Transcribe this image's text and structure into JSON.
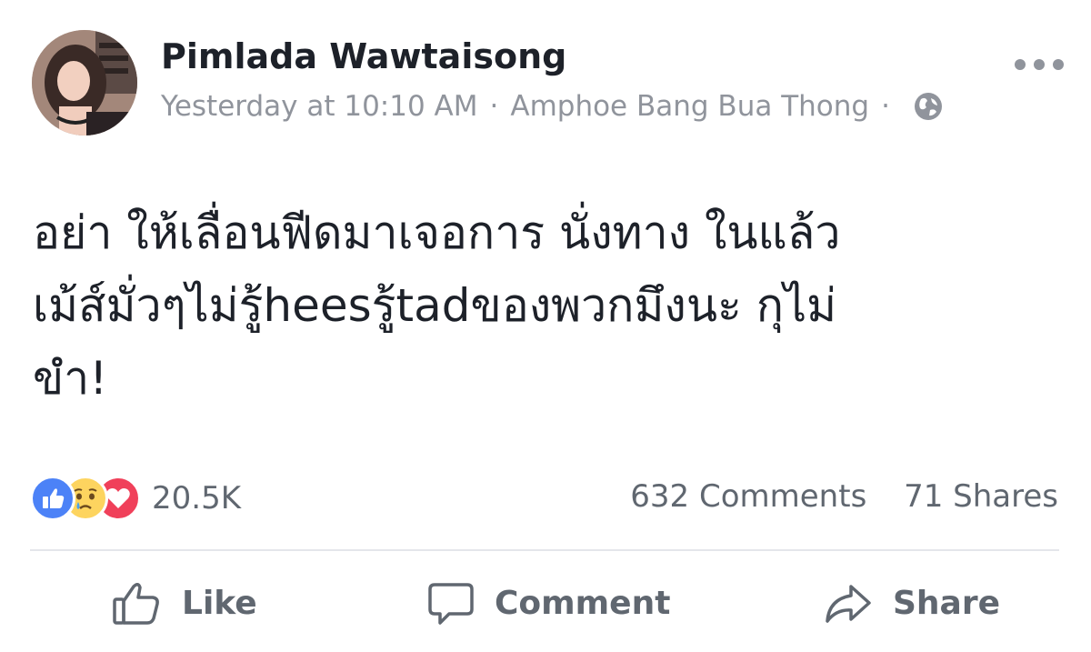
{
  "post": {
    "author": "Pimlada Wawtaisong",
    "timestamp": "Yesterday at 10:10 AM",
    "separator": "·",
    "location": "Amphoe Bang Bua Thong",
    "privacy_icon": "globe-icon",
    "text_lines": [
      "อย่า ให้เลื่อนฟีดมาเจอการ นั่งทาง ในแล้ว",
      "เม้ส์มั่วๆไม่รู้heesรู้tadของพวกมึงนะ กุไม่",
      "ขำ!"
    ]
  },
  "reactions": {
    "icons": [
      "like-reaction-icon",
      "sad-reaction-icon",
      "love-reaction-icon"
    ],
    "count": "20.5K"
  },
  "stats": {
    "comments": "632 Comments",
    "shares": "71 Shares"
  },
  "actions": {
    "like": "Like",
    "comment": "Comment",
    "share": "Share"
  },
  "colors": {
    "text": "#1d2129",
    "secondary": "#90949c",
    "like_blue": "#4c82f7",
    "love_red": "#f0405a",
    "sad_yellow": "#fdd45f"
  }
}
